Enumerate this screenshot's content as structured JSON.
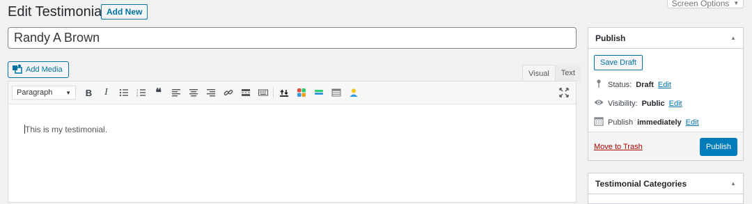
{
  "screen_options": {
    "label": "Screen Options",
    "caret": "▼"
  },
  "page": {
    "title": "Edit Testimonial",
    "add_new_label": "Add New"
  },
  "post": {
    "title": "Randy A Brown"
  },
  "editor": {
    "add_media_label": "Add Media",
    "tabs": [
      {
        "label": "Visual",
        "active": true
      },
      {
        "label": "Text",
        "active": false
      }
    ],
    "format_select": {
      "value": "Paragraph"
    },
    "toolbar": {
      "bold": "B",
      "italic": "I",
      "blockquote": "❝"
    },
    "content": "This is my testimonial."
  },
  "publish_box": {
    "title": "Publish",
    "save_draft_label": "Save Draft",
    "status": {
      "label": "Status:",
      "value": "Draft",
      "edit": "Edit"
    },
    "visibility": {
      "label": "Visibility:",
      "value": "Public",
      "edit": "Edit"
    },
    "schedule": {
      "label": "Publish",
      "value": "immediately",
      "edit": "Edit"
    },
    "trash_label": "Move to Trash",
    "publish_label": "Publish"
  },
  "categories_box": {
    "title": "Testimonial Categories"
  },
  "colors": {
    "accent": "#0071a1",
    "primary_button": "#007cba",
    "trash": "#a00",
    "link": "#0073aa"
  }
}
